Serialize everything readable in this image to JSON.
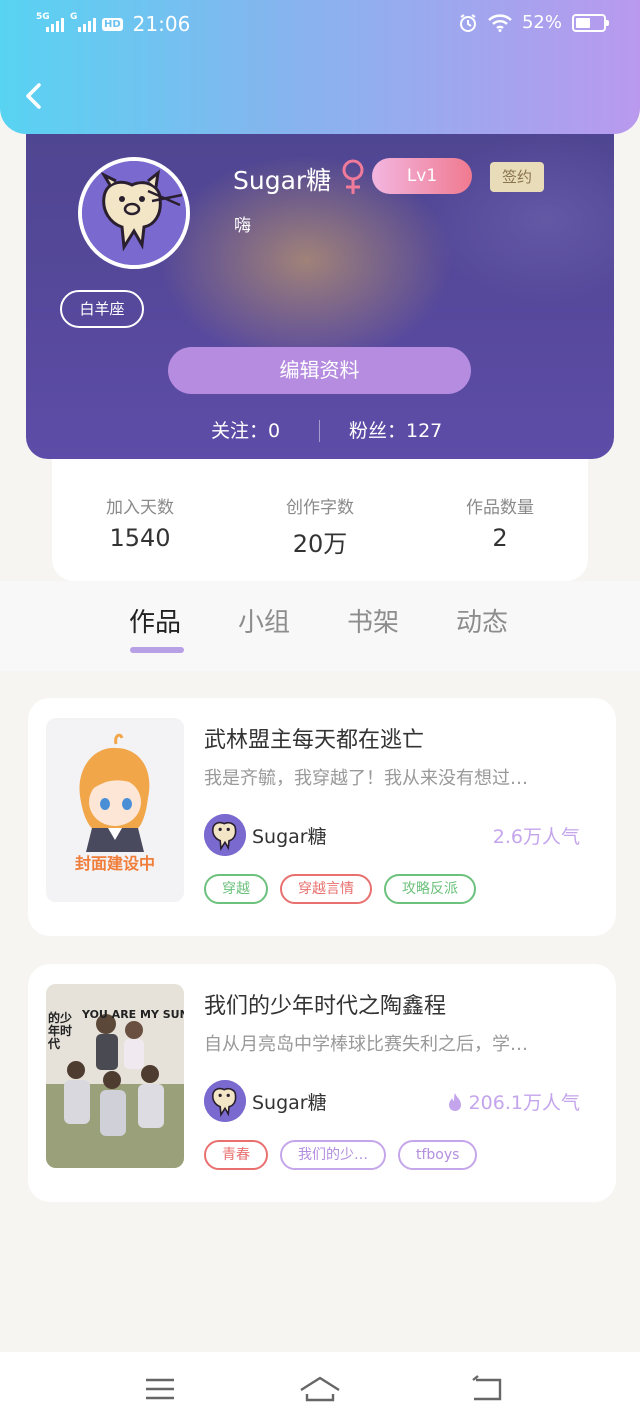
{
  "status_bar": {
    "sim1": "5G",
    "sim2": "G",
    "hd": "HD",
    "time": "21:06",
    "battery": "52%",
    "battery_level": 0.52
  },
  "profile": {
    "username": "Sugar糖",
    "level": "Lv1",
    "signed_badge": "签约",
    "bio": "嗨",
    "zodiac": "白羊座",
    "edit_button": "编辑资料",
    "following": "关注：0",
    "fans": "粉丝：127"
  },
  "stats": [
    {
      "label": "加入天数",
      "value": "1540"
    },
    {
      "label": "创作字数",
      "value": "20万"
    },
    {
      "label": "作品数量",
      "value": "2"
    }
  ],
  "tabs": [
    "作品",
    "小组",
    "书架",
    "动态"
  ],
  "books": [
    {
      "title": "武林盟主每天都在逃亡",
      "desc": "我是齐毓，我穿越了！我从来没有想过…",
      "author": "Sugar糖",
      "popularity": "2.6万人气",
      "cover_caption": "封面建设中",
      "tags": [
        "穿越",
        "穿越言情",
        "攻略反派"
      ]
    },
    {
      "title": "我们的少年时代之陶鑫程",
      "desc": "自从月亮岛中学棒球比赛失利之后，学…",
      "author": "Sugar糖",
      "popularity": "206.1万人气",
      "cover_caption": "YOU ARE MY SUNSH",
      "cover_caption_2": "的少年时代",
      "tags": [
        "青春",
        "我们的少…",
        "tfboys"
      ]
    }
  ],
  "colors": {
    "header_gradient": [
      "#58d3f2",
      "#b999ee"
    ],
    "accent_purple": "#b58ce0",
    "tag_green": "#6cc17c",
    "tag_red": "#e8716f",
    "tag_purple": "#c6a6ea",
    "popularity": "#c4a5ec"
  },
  "icons": {
    "back": "chevron-left-icon",
    "gender": "female-icon",
    "fire": "fire-icon",
    "alarm": "alarm-icon",
    "wifi": "wifi-icon",
    "nav_menu": "menu-icon",
    "nav_home": "home-icon",
    "nav_back": "back-icon"
  }
}
